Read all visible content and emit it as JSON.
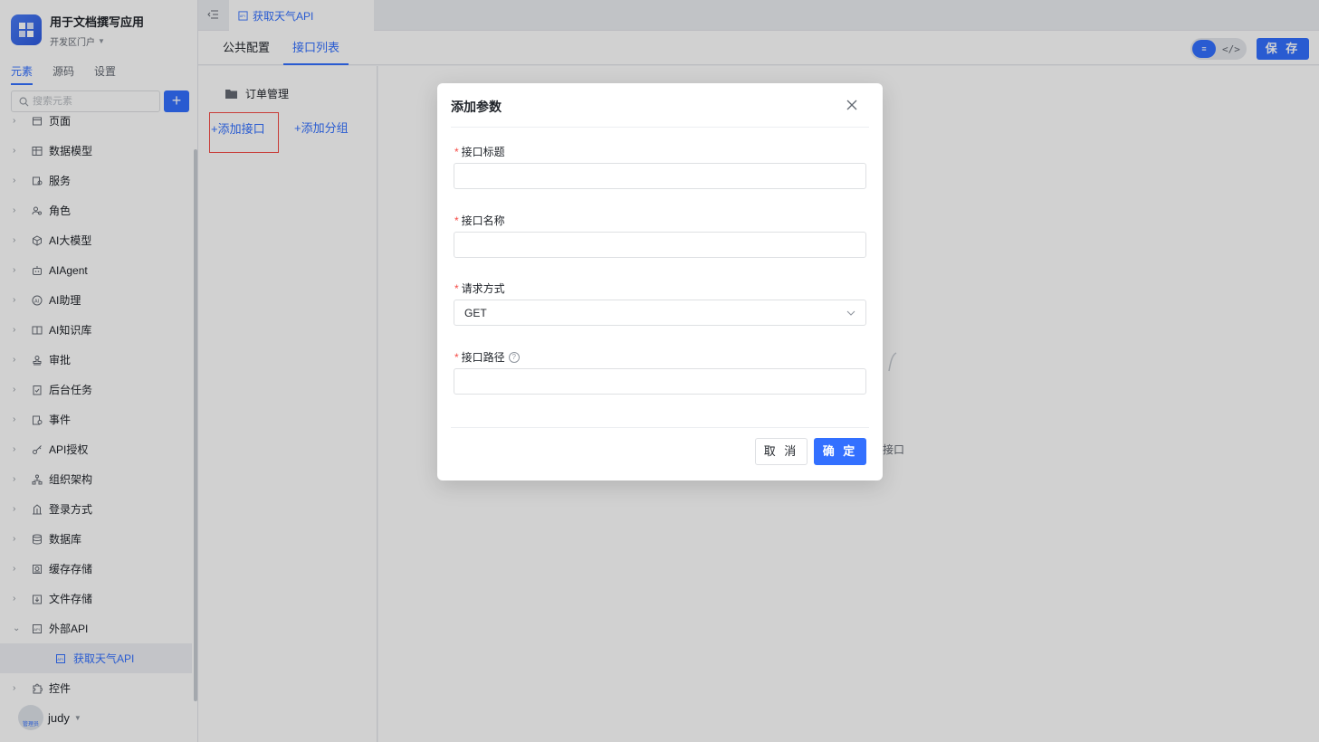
{
  "app": {
    "name": "用于文档撰写应用",
    "portal": "开发区门户"
  },
  "sidebar": {
    "tabs": [
      {
        "label": "元素",
        "active": true
      },
      {
        "label": "源码",
        "active": false
      },
      {
        "label": "设置",
        "active": false
      }
    ],
    "search_placeholder": "搜索元素",
    "items": [
      {
        "label": "页面",
        "icon": "page-icon"
      },
      {
        "label": "数据模型",
        "icon": "table-icon"
      },
      {
        "label": "服务",
        "icon": "service-icon"
      },
      {
        "label": "角色",
        "icon": "role-icon"
      },
      {
        "label": "AI大模型",
        "icon": "cube-icon"
      },
      {
        "label": "AIAgent",
        "icon": "robot-icon"
      },
      {
        "label": "AI助理",
        "icon": "ai-assistant-icon"
      },
      {
        "label": "AI知识库",
        "icon": "book-icon"
      },
      {
        "label": "审批",
        "icon": "stamp-icon"
      },
      {
        "label": "后台任务",
        "icon": "task-icon"
      },
      {
        "label": "事件",
        "icon": "event-icon"
      },
      {
        "label": "API授权",
        "icon": "key-icon"
      },
      {
        "label": "组织架构",
        "icon": "org-icon"
      },
      {
        "label": "登录方式",
        "icon": "login-icon"
      },
      {
        "label": "数据库",
        "icon": "database-icon"
      },
      {
        "label": "缓存存储",
        "icon": "cache-icon"
      },
      {
        "label": "文件存储",
        "icon": "file-storage-icon"
      },
      {
        "label": "外部API",
        "icon": "api-icon",
        "expanded": true
      },
      {
        "label": "获取天气API",
        "icon": "api-icon",
        "child": true,
        "selected": true
      },
      {
        "label": "控件",
        "icon": "puzzle-icon"
      }
    ],
    "user": {
      "name": "judy",
      "avatar_text": "管理员"
    }
  },
  "topbar": {
    "open_tab": "获取天气API"
  },
  "subheader": {
    "tabs": [
      {
        "label": "公共配置",
        "active": false
      },
      {
        "label": "接口列表",
        "active": true
      }
    ],
    "save_label": "保 存",
    "code_toggle_label": "</>"
  },
  "left_pane": {
    "folder": "订单管理",
    "add_api": "+添加接口",
    "add_group": "+添加分组"
  },
  "main": {
    "empty_hint": "接口"
  },
  "modal": {
    "title": "添加参数",
    "fields": [
      {
        "label": "接口标题",
        "required": true,
        "type": "text",
        "value": ""
      },
      {
        "label": "接口名称",
        "required": true,
        "type": "text",
        "value": ""
      },
      {
        "label": "请求方式",
        "required": true,
        "type": "select",
        "value": "GET"
      },
      {
        "label": "接口路径",
        "required": true,
        "type": "text",
        "value": "",
        "help": true
      }
    ],
    "cancel_label": "取 消",
    "ok_label": "确 定"
  },
  "colors": {
    "accent": "#3370ff",
    "danger": "#f54a45"
  }
}
